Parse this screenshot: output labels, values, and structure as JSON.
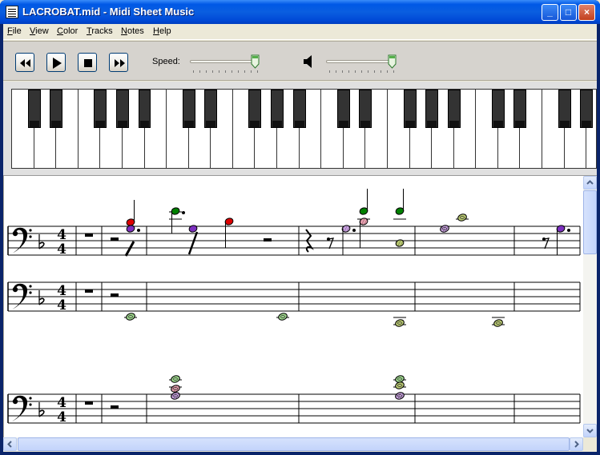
{
  "window": {
    "title": "LACROBAT.mid - Midi Sheet Music",
    "min_label": "_",
    "max_label": "□",
    "close_label": "×"
  },
  "menu": {
    "items": [
      {
        "first": "F",
        "rest": "ile"
      },
      {
        "first": "V",
        "rest": "iew"
      },
      {
        "first": "C",
        "rest": "olor"
      },
      {
        "first": "T",
        "rest": "racks"
      },
      {
        "first": "N",
        "rest": "otes"
      },
      {
        "first": "H",
        "rest": "elp"
      }
    ]
  },
  "toolbar": {
    "speed_label": "Speed:",
    "speed_value": 0.95,
    "volume_value": 0.95
  },
  "icons": {
    "rewind": "rewind-icon",
    "play": "play-icon",
    "stop": "stop-icon",
    "fast_forward": "fast-forward-icon",
    "volume": "speaker-icon"
  },
  "colors": {
    "note_red": "#DD0000",
    "note_green": "#008000",
    "note_purple": "#7B2FBE",
    "note_olive": "#B8C870",
    "note_pink": "#E8A0B0",
    "note_lavender": "#C8A0E0",
    "note_lightgreen": "#9BD48A",
    "staff_line": "#000000"
  },
  "sheet": {
    "time_signature": {
      "top": "4",
      "bottom": "4"
    }
  }
}
